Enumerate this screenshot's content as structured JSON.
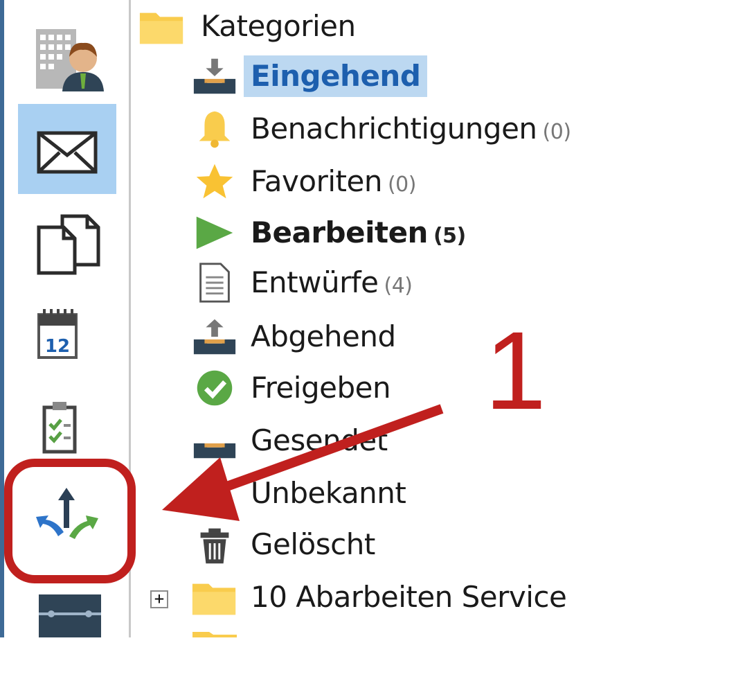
{
  "colors": {
    "accent_selected_bg": "#bcd8f1",
    "accent_selected_text": "#1d5fae",
    "annotation_red": "#c0201e",
    "folder_yellow": "#f9cc4d",
    "nav_active_bg": "#a9d0f2"
  },
  "nav": {
    "items": [
      {
        "icon": "contacts-building-person-icon",
        "active": false
      },
      {
        "icon": "mail-envelope-icon",
        "active": true
      },
      {
        "icon": "documents-copy-icon",
        "active": false
      },
      {
        "icon": "calendar-12-icon",
        "active": false,
        "text": "12"
      },
      {
        "icon": "tasks-clipboard-checklist-icon",
        "active": false
      },
      {
        "icon": "workflow-split-arrows-icon",
        "active": false
      },
      {
        "icon": "timeline-bar-icon",
        "active": false
      }
    ]
  },
  "tree": {
    "root_label": "Kategorien",
    "items": [
      {
        "label": "Eingehend",
        "count": "",
        "icon": "inbox-tray-down-icon",
        "selected": true,
        "bold": false
      },
      {
        "label": "Benachrichtigungen",
        "count": "(0)",
        "icon": "bell-icon",
        "selected": false,
        "bold": false
      },
      {
        "label": "Favoriten",
        "count": "(0)",
        "icon": "star-icon",
        "selected": false,
        "bold": false
      },
      {
        "label": "Bearbeiten",
        "count": "(5)",
        "icon": "play-triangle-icon",
        "selected": false,
        "bold": true
      },
      {
        "label": "Entwürfe",
        "count": "(4)",
        "icon": "document-page-icon",
        "selected": false,
        "bold": false
      },
      {
        "label": "Abgehend",
        "count": "",
        "icon": "outbox-tray-up-icon",
        "selected": false,
        "bold": false
      },
      {
        "label": "Freigeben",
        "count": "",
        "icon": "check-circle-icon",
        "selected": false,
        "bold": false
      },
      {
        "label": "Gesendet",
        "count": "",
        "icon": "tray-sent-icon",
        "selected": false,
        "bold": false
      },
      {
        "label": "Unbekannt",
        "count": "",
        "icon": "warning-icon",
        "selected": false,
        "bold": false
      },
      {
        "label": "Gelöscht",
        "count": "",
        "icon": "trash-icon",
        "selected": false,
        "bold": false
      }
    ],
    "subfolder": {
      "label": "10 Abarbeiten Service",
      "expander": "+",
      "icon": "folder-icon"
    }
  },
  "annotation": {
    "number": "1"
  }
}
